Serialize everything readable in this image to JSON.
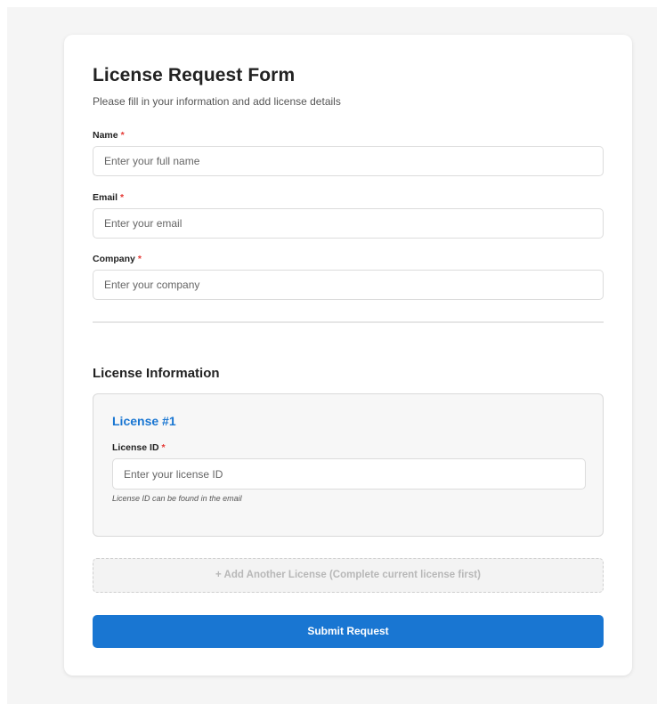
{
  "form": {
    "title": "License Request Form",
    "subtitle": "Please fill in your information and add license details",
    "required_marker": "*",
    "fields": {
      "name": {
        "label": "Name",
        "placeholder": "Enter your full name",
        "value": ""
      },
      "email": {
        "label": "Email",
        "placeholder": "Enter your email",
        "value": ""
      },
      "company": {
        "label": "Company",
        "placeholder": "Enter your company",
        "value": ""
      }
    }
  },
  "license_section": {
    "title": "License Information",
    "licenses": [
      {
        "heading": "License #1",
        "label": "License ID",
        "placeholder": "Enter your license ID",
        "value": "",
        "hint": "License ID can be found in the email"
      }
    ],
    "add_button_label": "+ Add Another License (Complete current license first)",
    "add_button_disabled": true
  },
  "submit_label": "Submit Request",
  "colors": {
    "accent": "#1976d2",
    "required": "#e53935",
    "background": "#f5f5f5",
    "card": "#ffffff",
    "license_card": "#f7f7f7",
    "disabled_text": "#b8b8b8"
  }
}
